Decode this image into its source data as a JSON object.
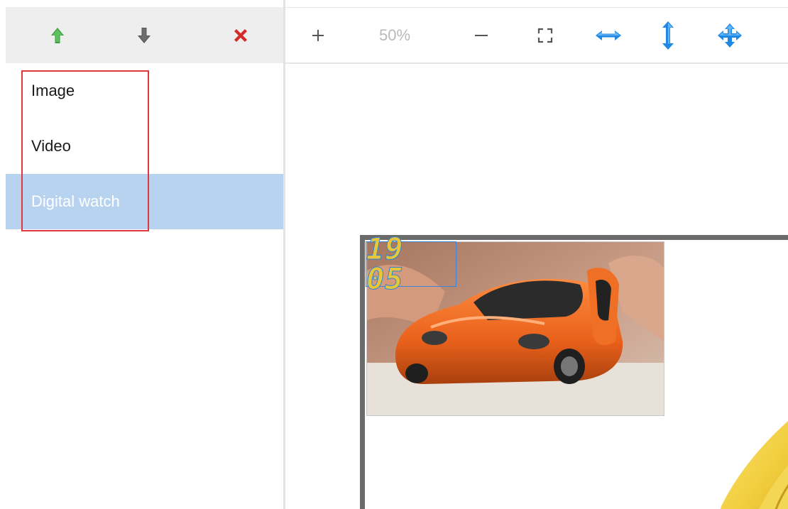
{
  "left_toolbar": {
    "buttons": [
      {
        "name": "move-up",
        "icon": "arrow-up-icon",
        "color": "#4caf50"
      },
      {
        "name": "move-down",
        "icon": "arrow-down-icon",
        "color": "#666666"
      },
      {
        "name": "delete",
        "icon": "close-icon",
        "color": "#d32f2f"
      }
    ]
  },
  "layers": {
    "items": [
      {
        "label": "Image",
        "selected": false
      },
      {
        "label": "Video",
        "selected": false
      },
      {
        "label": "Digital watch",
        "selected": true
      }
    ],
    "selected_bg": "#b7d3ef"
  },
  "right_toolbar": {
    "zoom_in_icon": "plus-icon",
    "zoom_level": "50%",
    "zoom_out_icon": "minus-icon",
    "fit_icon": "fullscreen-icon",
    "fit_width_icon": "horizontal-arrows-icon",
    "fit_height_icon": "vertical-arrows-icon",
    "move_icon": "move-arrows-icon",
    "accent": "#1e88e5"
  },
  "canvas": {
    "watch_text": "19 05",
    "watch_color": "#e9c53a",
    "frame_color": "#6b6b6b"
  }
}
